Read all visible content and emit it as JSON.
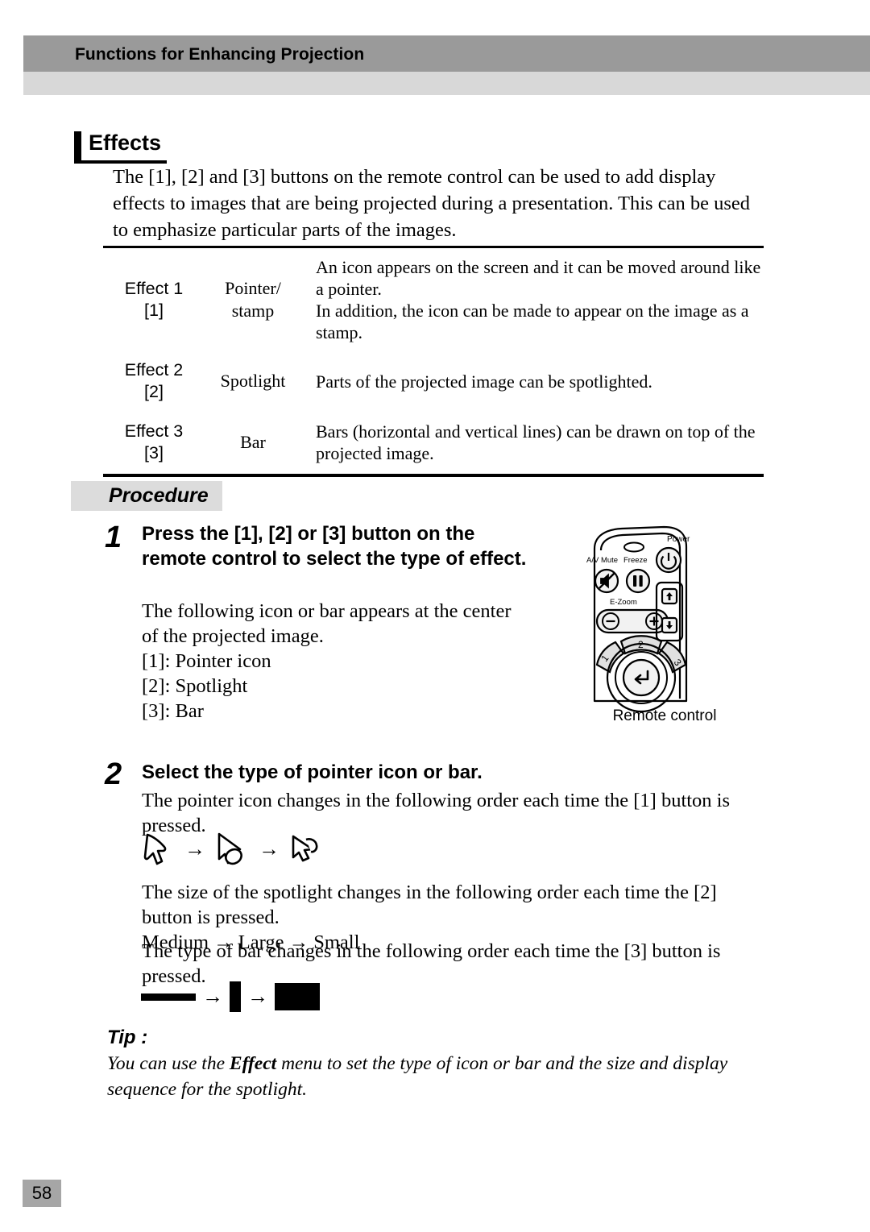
{
  "header": {
    "title": "Functions for Enhancing Projection"
  },
  "section": {
    "heading": "Effects",
    "intro": "The [1], [2] and [3] buttons on the remote control can be used to add display effects to images that are being projected during a presentation. This can be used to emphasize particular parts of the images."
  },
  "effects_table": {
    "rows": [
      {
        "effect": "Effect 1\n[1]",
        "name": "Pointer/\nstamp",
        "description": "An icon appears on the screen and it can be moved around like a pointer.\nIn addition, the icon can be made to appear on the image as a stamp."
      },
      {
        "effect": "Effect 2\n[2]",
        "name": "Spotlight",
        "description": "Parts of the projected image can be spotlighted."
      },
      {
        "effect": "Effect 3\n[3]",
        "name": "Bar",
        "description": "Bars (horizontal and vertical lines) can be drawn on top of the projected image."
      }
    ]
  },
  "procedure": {
    "badge": "Procedure",
    "step1": {
      "number": "1",
      "title": "Press the [1], [2] or [3] button on the remote control to select the type of effect.",
      "body": "The following icon or bar appears at the center of the projected image.\n[1]: Pointer icon\n[2]: Spotlight\n[3]: Bar"
    },
    "step2": {
      "number": "2",
      "title": "Select the type of pointer icon or bar.",
      "body_a": "The pointer icon changes in the following order each time the [1] button is pressed.",
      "pointer_sequence": [
        "pointer-icon-1",
        "pointer-icon-2",
        "pointer-icon-3"
      ],
      "body_b": "The size of the spotlight changes in the following order each time the [2] button is pressed.\nMedium → Large → Small",
      "body_c": "The type of bar changes in the following order each time the [3] button is pressed.",
      "bar_sequence": [
        "bar-horizontal-thin",
        "bar-vertical-narrow",
        "bar-filled-block"
      ],
      "arrow": "→"
    }
  },
  "tip": {
    "heading": "Tip :",
    "text_before": "You can use the ",
    "emphasis": "Effect",
    "text_after": " menu to set the type of icon or bar and the size and display sequence for the spotlight."
  },
  "remote": {
    "caption": "Remote control",
    "labels": {
      "power": "Power",
      "av_mute": "A/V Mute",
      "freeze": "Freeze",
      "ezoom": "E-Zoom",
      "minus": "−",
      "plus": "+",
      "btn1": "1",
      "btn2": "2",
      "btn3": "3"
    }
  },
  "footer": {
    "page_number": "58"
  }
}
